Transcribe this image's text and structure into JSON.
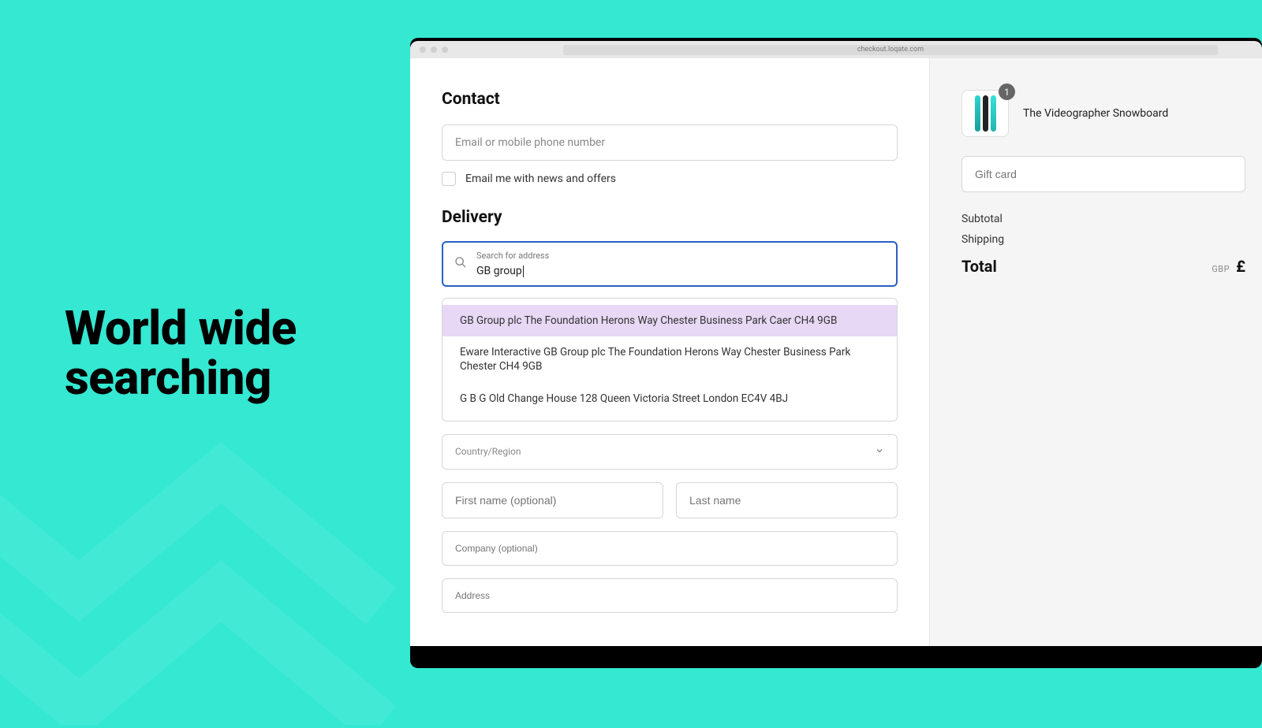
{
  "hero": {
    "line1": "World wide",
    "line2": "searching"
  },
  "browser": {
    "url": "checkout.loqate.com"
  },
  "contact": {
    "title": "Contact",
    "email_placeholder": "Email or mobile phone number",
    "news_label": "Email me with news and offers"
  },
  "delivery": {
    "title": "Delivery",
    "search_label": "Search for address",
    "search_value": "GB group",
    "suggestions": [
      "GB Group plc The Foundation Herons Way Chester Business Park Caer CH4 9GB",
      "Eware Interactive GB Group plc The Foundation Herons Way Chester Business Park Chester CH4 9GB",
      "G B G Old Change House 128 Queen Victoria Street London EC4V 4BJ"
    ],
    "country_label": "Country/Region",
    "first_name_placeholder": "First name (optional)",
    "last_name_placeholder": "Last name",
    "company_placeholder": "Company (optional)",
    "address_placeholder": "Address"
  },
  "order": {
    "product_name": "The Videographer Snowboard",
    "qty": "1",
    "gift_placeholder": "Gift card",
    "subtotal_label": "Subtotal",
    "shipping_label": "Shipping",
    "total_label": "Total",
    "total_currency": "GBP",
    "total_symbol": "£"
  }
}
